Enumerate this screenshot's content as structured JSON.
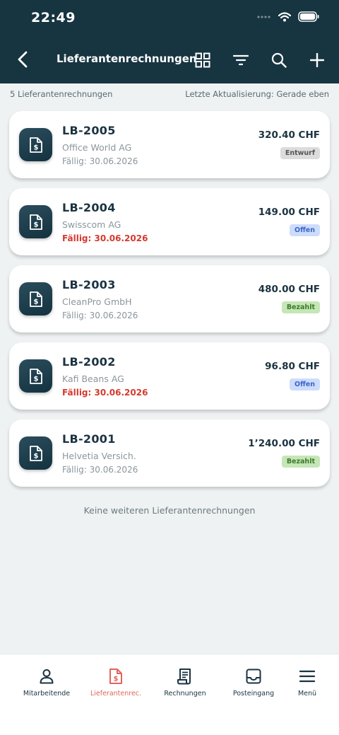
{
  "status_bar": {
    "time": "22:49"
  },
  "nav": {
    "title": "Lieferantenrechnungen"
  },
  "meta": {
    "count_text": "5 Lieferantenrechnungen",
    "updated_text": "Letzte Aktualisierung: Gerade eben"
  },
  "invoices": [
    {
      "number": "LB-2005",
      "vendor": "Office World AG",
      "due": "Fällig: 30.06.2026",
      "overdue": false,
      "amount": "320.40 CHF",
      "status": "Entwurf",
      "status_kind": "draft"
    },
    {
      "number": "LB-2004",
      "vendor": "Swisscom AG",
      "due": "Fällig: 30.06.2026",
      "overdue": true,
      "amount": "149.00 CHF",
      "status": "Offen",
      "status_kind": "open"
    },
    {
      "number": "LB-2003",
      "vendor": "CleanPro GmbH",
      "due": "Fällig: 30.06.2026",
      "overdue": false,
      "amount": "480.00 CHF",
      "status": "Bezahlt",
      "status_kind": "paid"
    },
    {
      "number": "LB-2002",
      "vendor": "Kafi Beans AG",
      "due": "Fällig: 30.06.2026",
      "overdue": true,
      "amount": "96.80 CHF",
      "status": "Offen",
      "status_kind": "open"
    },
    {
      "number": "LB-2001",
      "vendor": "Helvetia Versich.",
      "due": "Fällig: 30.06.2026",
      "overdue": false,
      "amount": "1’240.00 CHF",
      "status": "Bezahlt",
      "status_kind": "paid"
    }
  ],
  "end_note": "Keine weiteren Lieferantenrechnungen",
  "tabs": [
    {
      "label": "Mitarbeitende",
      "icon": "person-icon",
      "active": false
    },
    {
      "label": "Lieferantenrec.",
      "icon": "invoice-dollar-icon",
      "active": true
    },
    {
      "label": "Rechnungen",
      "icon": "receipt-icon",
      "active": false
    },
    {
      "label": "Posteingang",
      "icon": "inbox-icon",
      "active": false
    },
    {
      "label": "Menü",
      "icon": "menu-icon",
      "active": false
    }
  ],
  "colors": {
    "header": "#173441",
    "accent": "#e0665b",
    "overdue": "#d43a2f"
  }
}
